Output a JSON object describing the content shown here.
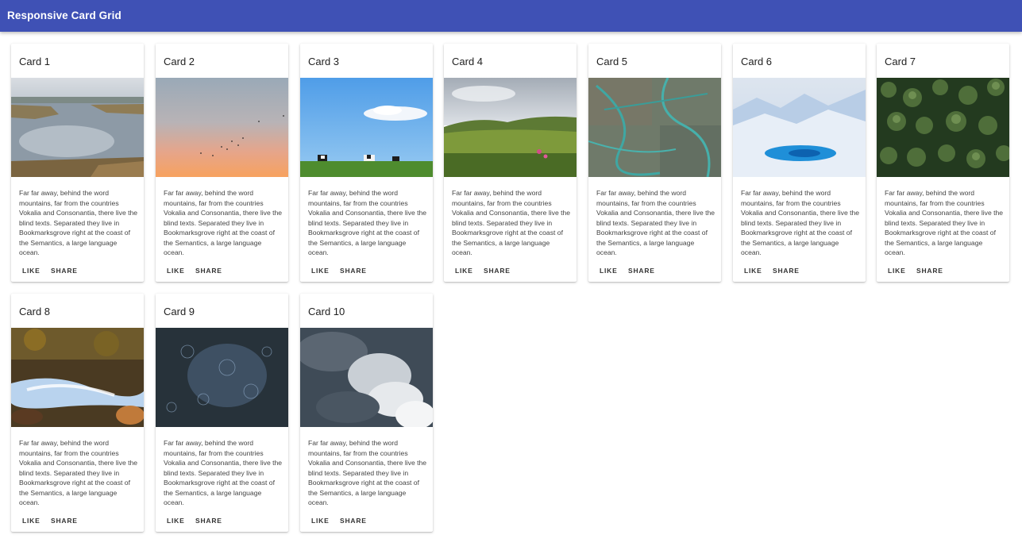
{
  "app": {
    "title": "Responsive Card Grid",
    "bar_color": "#3f51b5"
  },
  "cards": [
    {
      "title": "Card 1",
      "image": "lake-marsh-reflection",
      "text": "Far far away, behind the word mountains, far from the countries Vokalia and Consonantia, there live the blind texts. Separated they live in Bookmarksgrove right at the coast of the Semantics, a large language ocean.",
      "like": "LIKE",
      "share": "SHARE"
    },
    {
      "title": "Card 2",
      "image": "sunset-sky-birds",
      "text": "Far far away, behind the word mountains, far from the countries Vokalia and Consonantia, there live the blind texts. Separated they live in Bookmarksgrove right at the coast of the Semantics, a large language ocean.",
      "like": "LIKE",
      "share": "SHARE"
    },
    {
      "title": "Card 3",
      "image": "cows-green-field",
      "text": "Far far away, behind the word mountains, far from the countries Vokalia and Consonantia, there live the blind texts. Separated they live in Bookmarksgrove right at the coast of the Semantics, a large language ocean.",
      "like": "LIKE",
      "share": "SHARE"
    },
    {
      "title": "Card 4",
      "image": "grassy-hills",
      "text": "Far far away, behind the word mountains, far from the countries Vokalia and Consonantia, there live the blind texts. Separated they live in Bookmarksgrove right at the coast of the Semantics, a large language ocean.",
      "like": "LIKE",
      "share": "SHARE"
    },
    {
      "title": "Card 5",
      "image": "aerial-river-delta",
      "text": "Far far away, behind the word mountains, far from the countries Vokalia and Consonantia, there live the blind texts. Separated they live in Bookmarksgrove right at the coast of the Semantics, a large language ocean.",
      "like": "LIKE",
      "share": "SHARE"
    },
    {
      "title": "Card 6",
      "image": "glacier-ice",
      "text": "Far far away, behind the word mountains, far from the countries Vokalia and Consonantia, there live the blind texts. Separated they live in Bookmarksgrove right at the coast of the Semantics, a large language ocean.",
      "like": "LIKE",
      "share": "SHARE"
    },
    {
      "title": "Card 7",
      "image": "forest-aerial",
      "text": "Far far away, behind the word mountains, far from the countries Vokalia and Consonantia, there live the blind texts. Separated they live in Bookmarksgrove right at the coast of the Semantics, a large language ocean.",
      "like": "LIKE",
      "share": "SHARE"
    },
    {
      "title": "Card 8",
      "image": "rushing-stream",
      "text": "Far far away, behind the word mountains, far from the countries Vokalia and Consonantia, there live the blind texts. Separated they live in Bookmarksgrove right at the coast of the Semantics, a large language ocean.",
      "like": "LIKE",
      "share": "SHARE"
    },
    {
      "title": "Card 9",
      "image": "rain-on-water",
      "text": "Far far away, behind the word mountains, far from the countries Vokalia and Consonantia, there live the blind texts. Separated they live in Bookmarksgrove right at the coast of the Semantics, a large language ocean.",
      "like": "LIKE",
      "share": "SHARE"
    },
    {
      "title": "Card 10",
      "image": "storm-clouds",
      "text": "Far far away, behind the word mountains, far from the countries Vokalia and Consonantia, there live the blind texts. Separated they live in Bookmarksgrove right at the coast of the Semantics, a large language ocean.",
      "like": "LIKE",
      "share": "SHARE"
    }
  ]
}
